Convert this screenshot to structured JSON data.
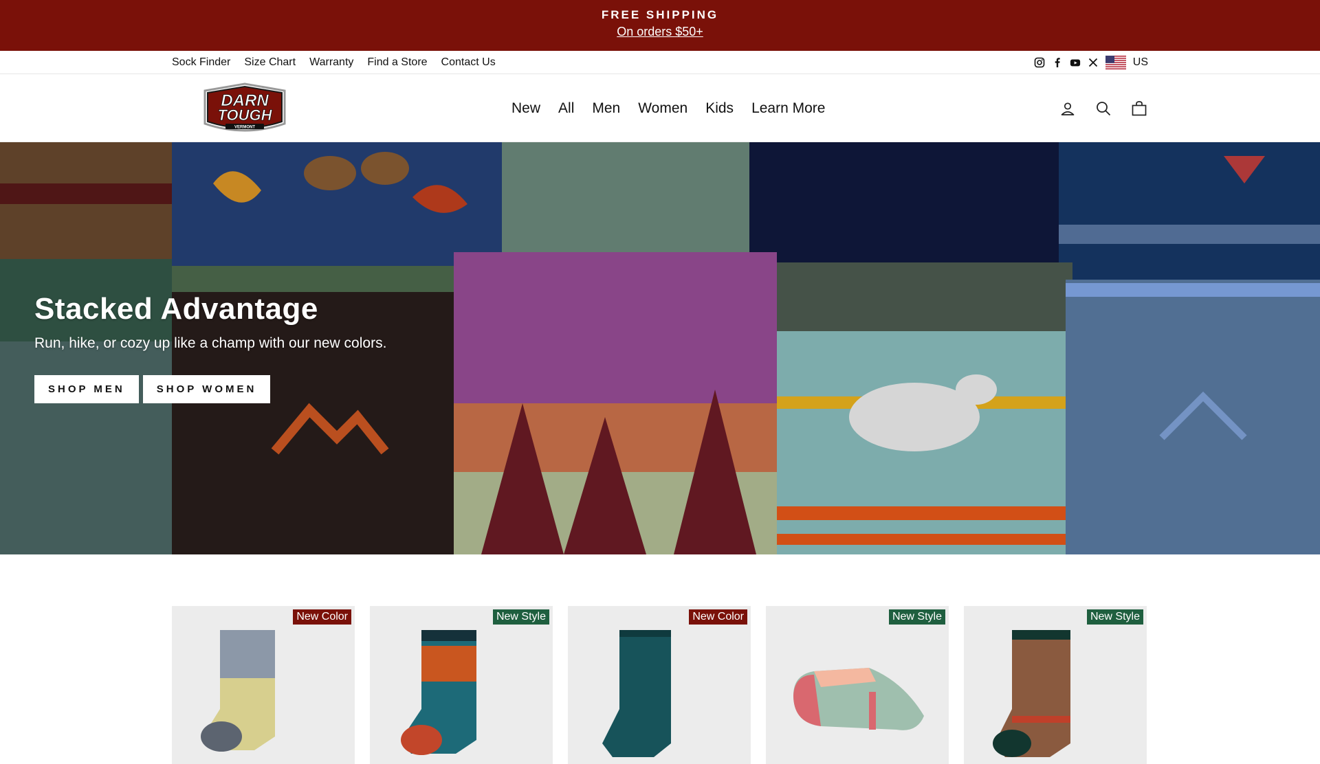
{
  "announcement": {
    "headline": "FREE SHIPPING",
    "subline": "On orders $50+",
    "bg_color": "#7a1109"
  },
  "utility_nav": {
    "links": [
      "Sock Finder",
      "Size Chart",
      "Warranty",
      "Find a Store",
      "Contact Us"
    ],
    "social_icons": [
      "instagram-icon",
      "facebook-icon",
      "youtube-icon",
      "x-icon"
    ],
    "country": "US"
  },
  "header": {
    "logo": {
      "line1": "DARN",
      "line2": "TOUGH",
      "line3": "VERMONT"
    },
    "nav": [
      "New",
      "All",
      "Men",
      "Women",
      "Kids",
      "Learn More"
    ],
    "icons": [
      "account-icon",
      "search-icon",
      "cart-icon"
    ]
  },
  "hero": {
    "title": "Stacked Advantage",
    "subtitle": "Run, hike, or cozy up like a champ with our new colors.",
    "buttons": [
      "SHOP MEN",
      "SHOP WOMEN"
    ]
  },
  "products": [
    {
      "badge": "New Color",
      "badge_color": "#7a1109"
    },
    {
      "badge": "New Style",
      "badge_color": "#1f5f3f"
    },
    {
      "badge": "New Color",
      "badge_color": "#7a1109"
    },
    {
      "badge": "New Style",
      "badge_color": "#1f5f3f"
    },
    {
      "badge": "New Style",
      "badge_color": "#1f5f3f"
    }
  ]
}
